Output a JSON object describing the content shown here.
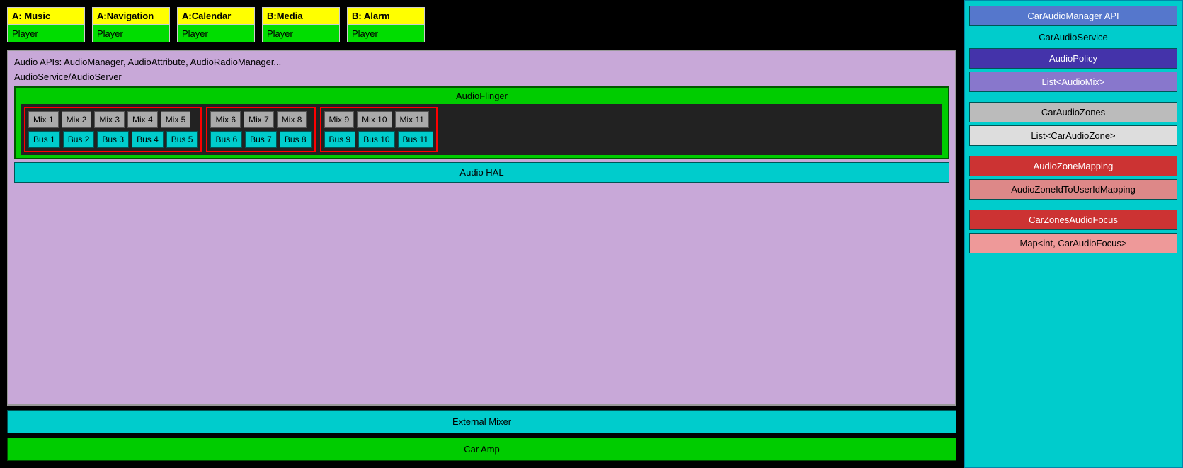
{
  "apps": [
    {
      "label": "A: Music",
      "player": "Player"
    },
    {
      "label": "A:Navigation",
      "player": "Player"
    },
    {
      "label": "A:Calendar",
      "player": "Player"
    },
    {
      "label": "B:Media",
      "player": "Player"
    },
    {
      "label": "B: Alarm",
      "player": "Player"
    }
  ],
  "audioStack": {
    "apisLabel": "Audio APIs: AudioManager, AudioAttribute, AudioRadioManager...",
    "serviceLabel": "AudioService/AudioServer",
    "audioFlingerLabel": "AudioFlinger"
  },
  "zones": [
    {
      "mixes": [
        "Mix 1",
        "Mix 2",
        "Mix 3",
        "Mix 4",
        "Mix 5"
      ],
      "buses": [
        "Bus 1",
        "Bus 2",
        "Bus 3",
        "Bus 4",
        "Bus 5"
      ]
    },
    {
      "mixes": [
        "Mix 6",
        "Mix 7",
        "Mix 8"
      ],
      "buses": [
        "Bus 6",
        "Bus 7",
        "Bus 8"
      ]
    },
    {
      "mixes": [
        "Mix 9",
        "Mix 10",
        "Mix 11"
      ],
      "buses": [
        "Bus 9",
        "Bus 10",
        "Bus 11"
      ]
    }
  ],
  "halLabel": "Audio HAL",
  "externalMixerLabel": "External Mixer",
  "carAmpLabel": "Car Amp",
  "rightPanel": {
    "carAudioManagerApi": "CarAudioManager API",
    "carAudioService": "CarAudioService",
    "audioPolicy": "AudioPolicy",
    "listAudioMix": "List<AudioMix>",
    "carAudioZones": "CarAudioZones",
    "listCarAudioZone": "List<CarAudioZone>",
    "audioZoneMapping": "AudioZoneMapping",
    "audioZoneIdToUserIdMapping": "AudioZoneIdToUserIdMapping",
    "carZonesAudioFocus": "CarZonesAudioFocus",
    "mapCarAudioFocus": "Map<int, CarAudioFocus>"
  }
}
